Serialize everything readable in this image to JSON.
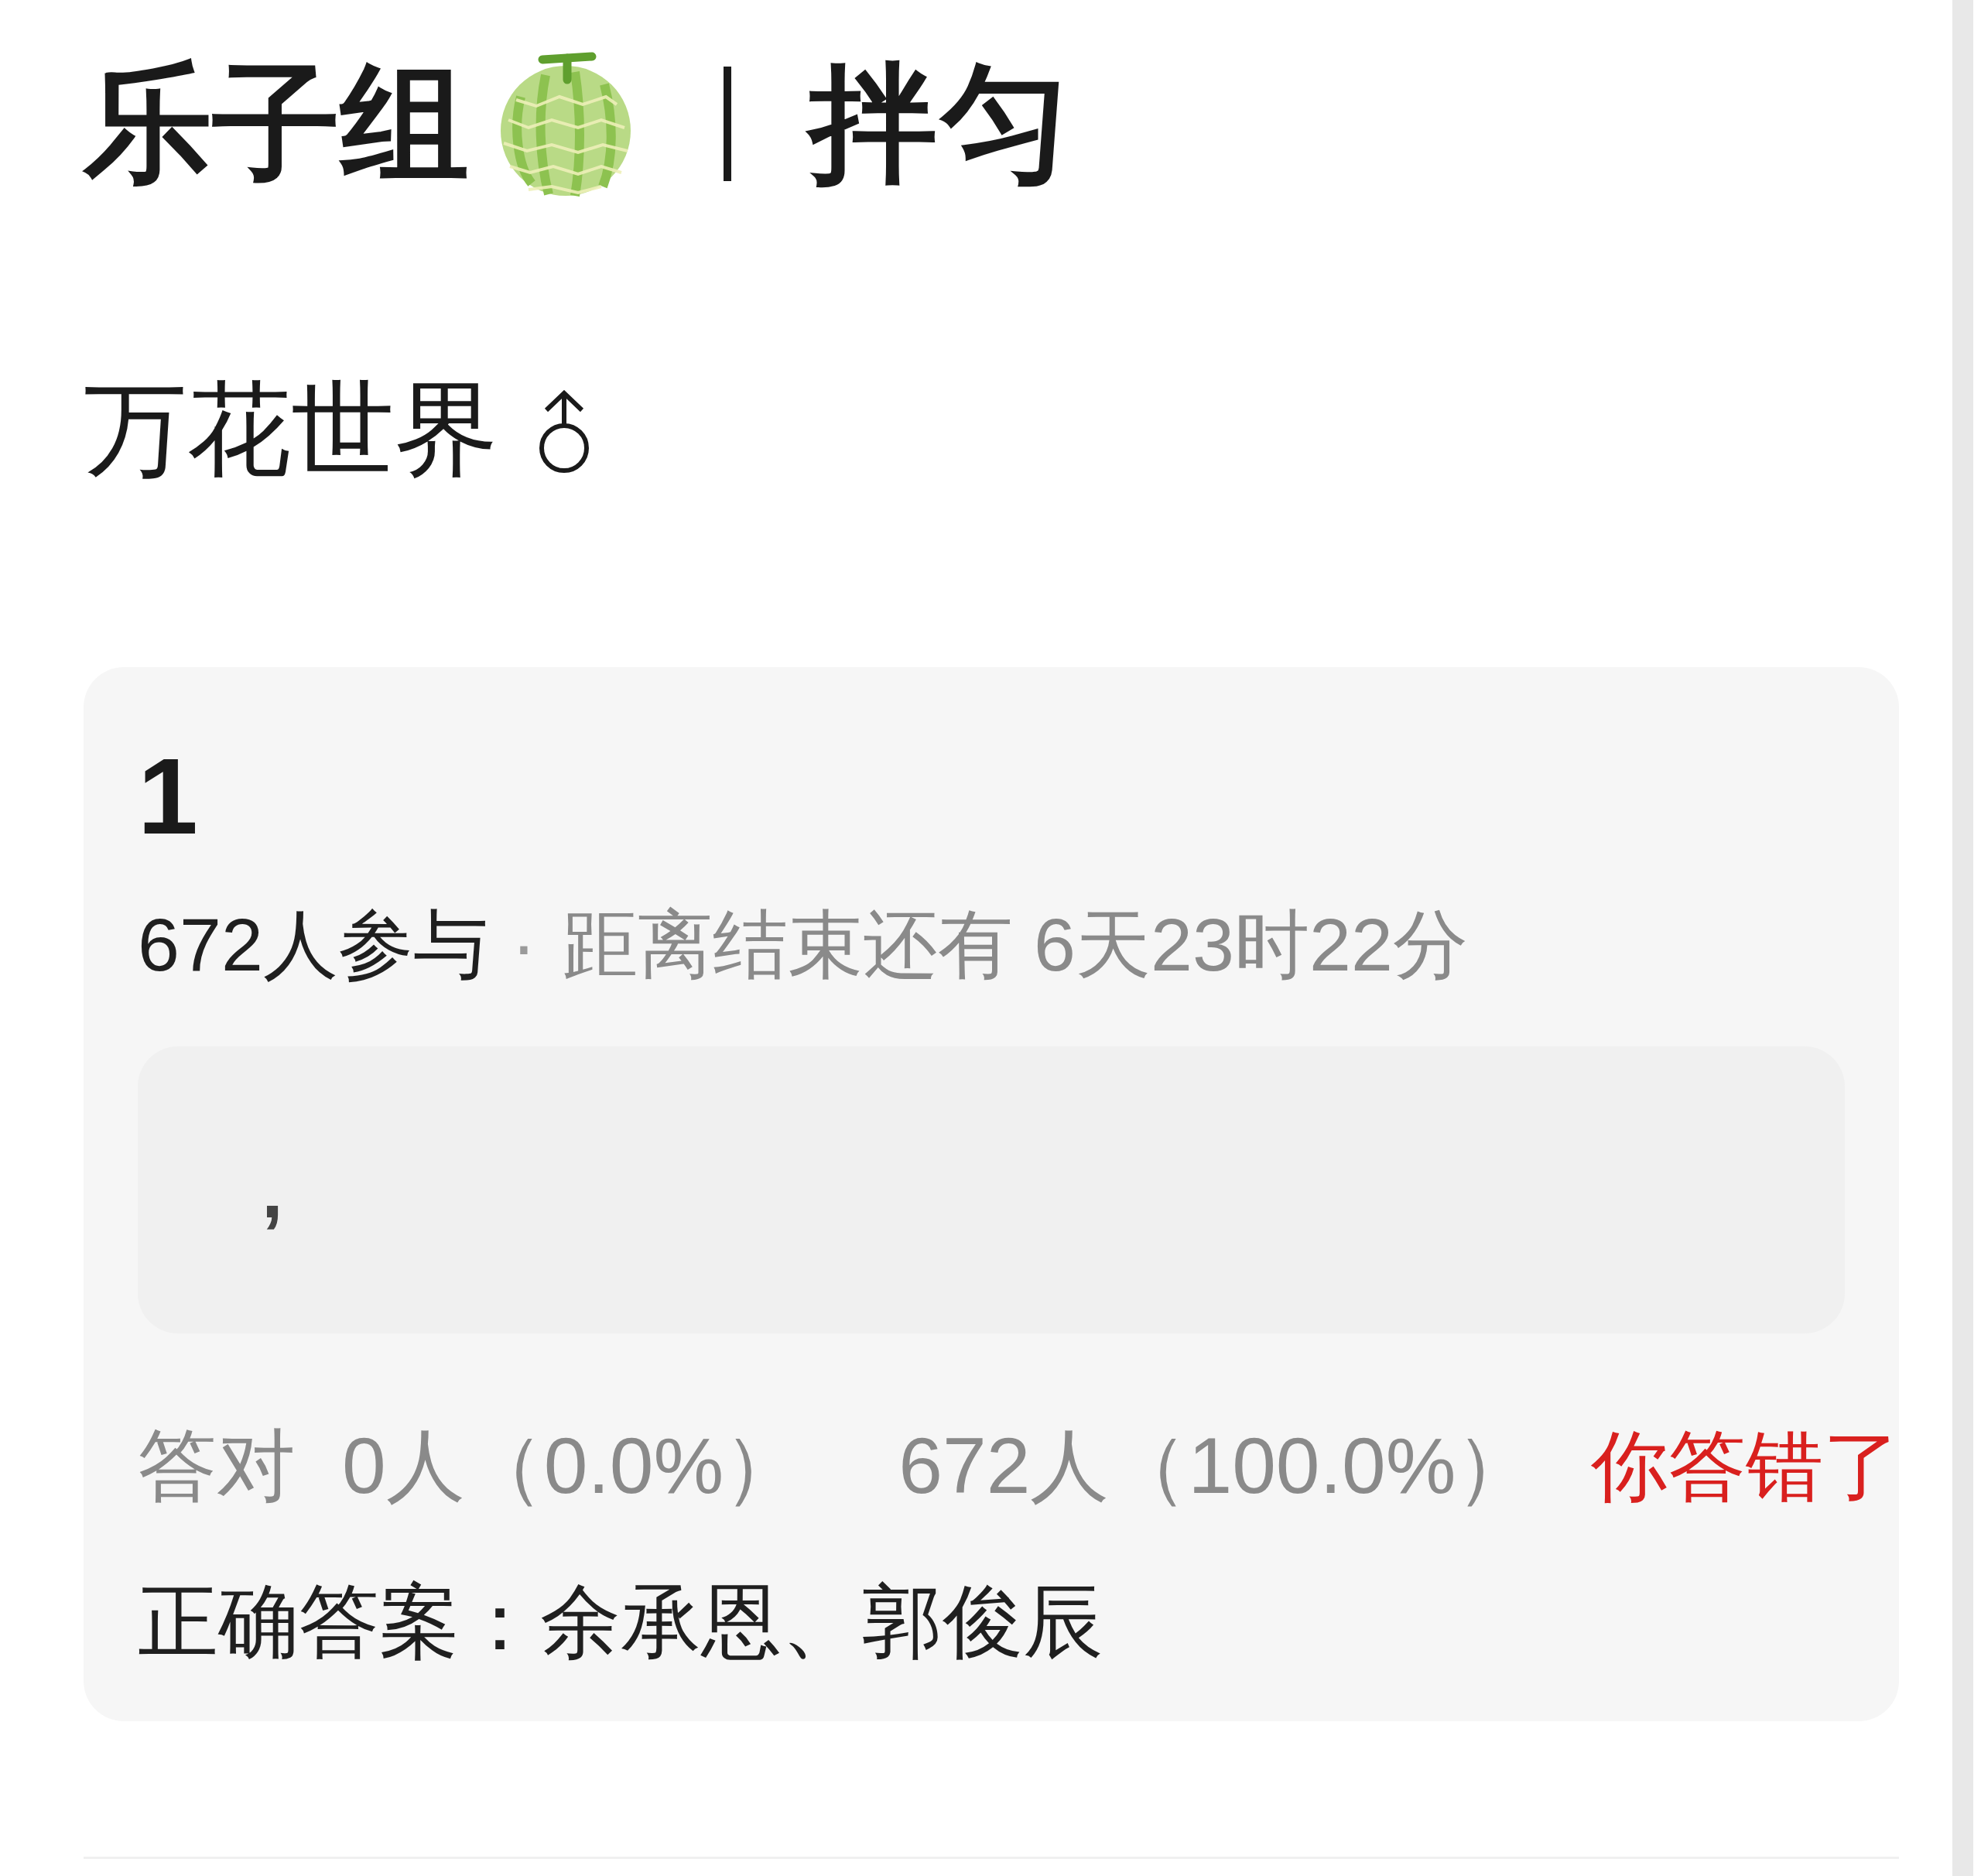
{
  "header": {
    "group": "乐子组",
    "title": "拌匀"
  },
  "user": {
    "name": "万花世界"
  },
  "question": {
    "number": "1",
    "participants": "672人参与",
    "separator": "·",
    "countdown": "距离结束还有 6天23时22分",
    "answer": ",",
    "stats": [
      {
        "label": "答对",
        "count": "0人（0.0%）"
      },
      {
        "count": "672人（100.0%）"
      }
    ],
    "verdict": {
      "text": "你答错了",
      "correct": false
    },
    "correct_answer": "正确答案：余承恩、郭俊辰"
  }
}
